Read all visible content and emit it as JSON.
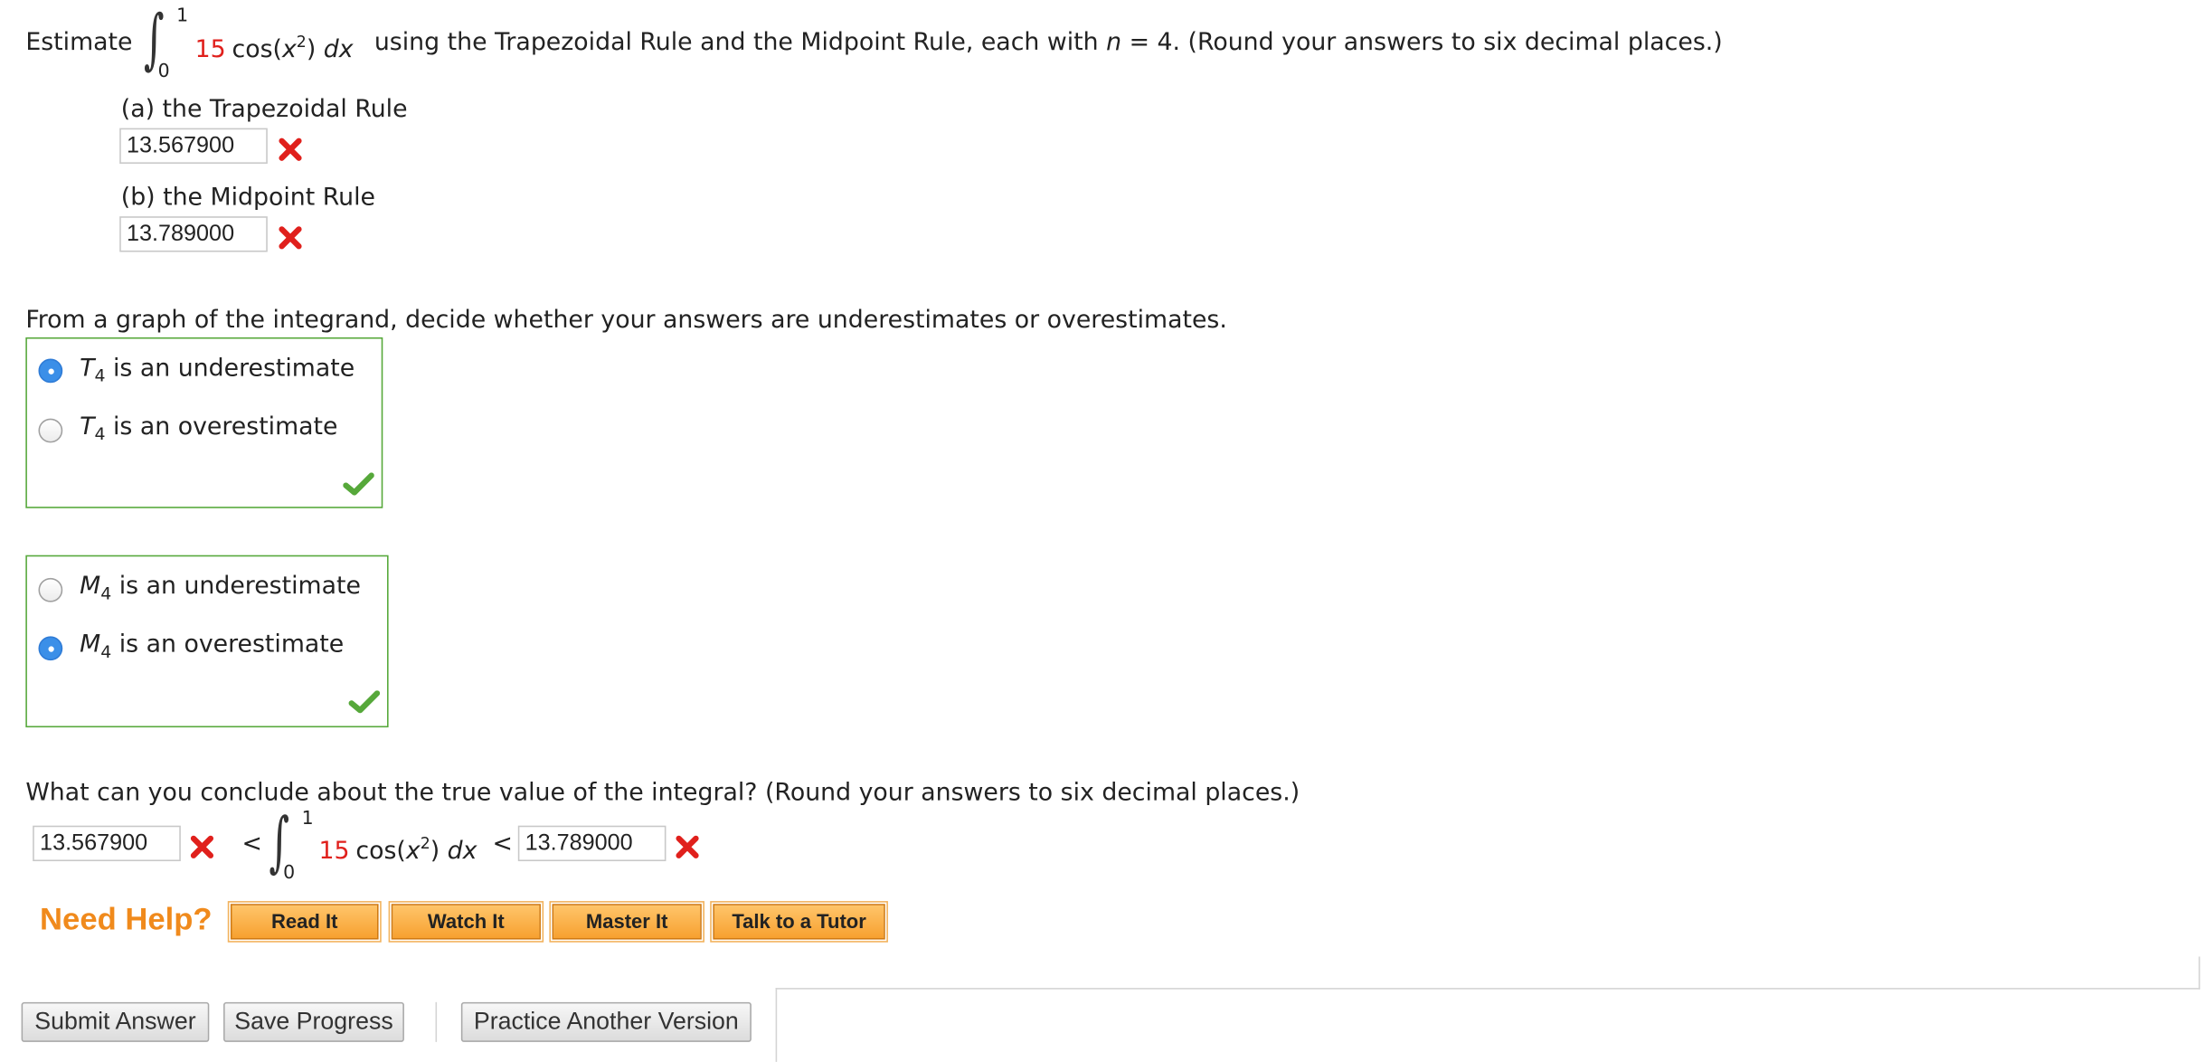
{
  "question": {
    "estimate_word": "Estimate",
    "coef": "15",
    "integrand": "cos(x²) dx",
    "upper": "1",
    "lower": "0",
    "instruction": "using the Trapezoidal Rule and the Midpoint Rule, each with n = 4. (Round your answers to six decimal places.)"
  },
  "part_a": {
    "label": "(a) the Trapezoidal Rule",
    "value": "13.567900",
    "status": "incorrect"
  },
  "part_b": {
    "label": "(b) the Midpoint Rule",
    "value": "13.789000",
    "status": "incorrect"
  },
  "graph_prompt": "From a graph of the integrand, decide whether your answers are underestimates or overestimates.",
  "group_t": {
    "options": [
      {
        "sym": "T",
        "sub": "4",
        "text": "is an underestimate",
        "selected": true
      },
      {
        "sym": "T",
        "sub": "4",
        "text": "is an overestimate",
        "selected": false
      }
    ],
    "status": "correct"
  },
  "group_m": {
    "options": [
      {
        "sym": "M",
        "sub": "4",
        "text": "is an underestimate",
        "selected": false
      },
      {
        "sym": "M",
        "sub": "4",
        "text": "is an overestimate",
        "selected": true
      }
    ],
    "status": "correct"
  },
  "conclude_prompt": "What can you conclude about the true value of the integral? (Round your answers to six decimal places.)",
  "bounds": {
    "lower_value": "13.567900",
    "upper_value": "13.789000",
    "lt": "<"
  },
  "help": {
    "title": "Need Help?",
    "buttons": [
      "Read It",
      "Watch It",
      "Master It",
      "Talk to a Tutor"
    ]
  },
  "actions": {
    "submit": "Submit Answer",
    "save": "Save Progress",
    "practice": "Practice Another Version"
  },
  "colors": {
    "incorrect": "#e0201c",
    "correct": "#56a83a",
    "selected_radio": "#3b8fe8",
    "help_orange": "#f7a130"
  }
}
